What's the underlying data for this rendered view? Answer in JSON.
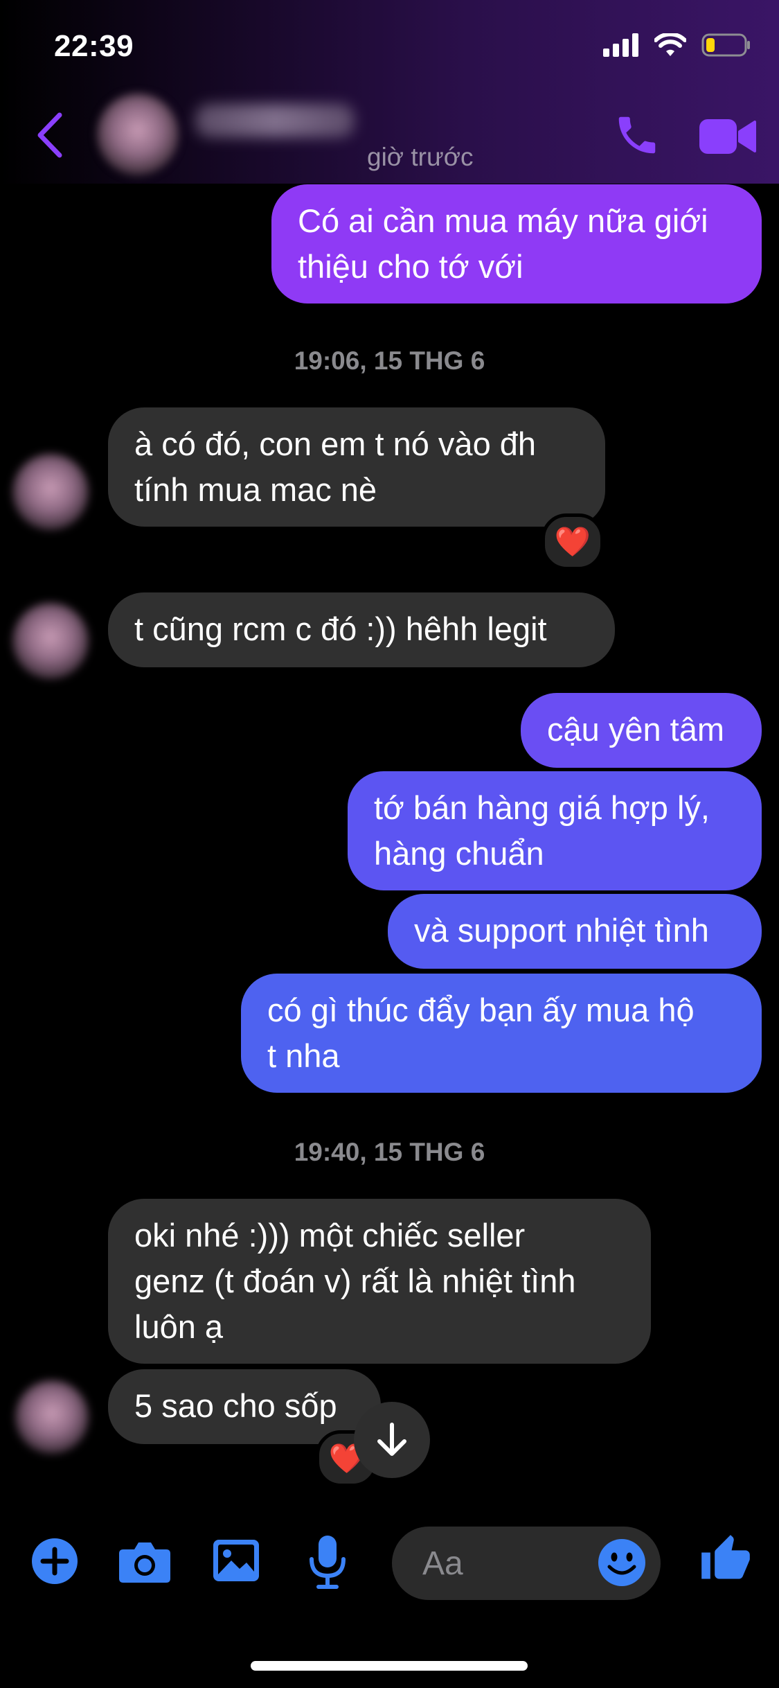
{
  "status_bar": {
    "time": "22:39",
    "icons": [
      "cellular-icon",
      "wifi-icon",
      "battery-icon"
    ]
  },
  "header": {
    "active_status": "giờ trước",
    "back_icon": "chevron-left-icon",
    "call_icon": "phone-icon",
    "video_icon": "video-camera-icon",
    "accent": "#8a3ffc"
  },
  "messages": [
    {
      "dir": "sent",
      "text": "Có ai cần mua máy nữa giới\nthiệu cho tớ với"
    },
    {
      "type": "timestamp",
      "text": "19:06, 15 THG 6"
    },
    {
      "dir": "received",
      "text": "à có đó, con em t nó vào đh\ntính mua mac nè",
      "reaction": "❤️"
    },
    {
      "dir": "received",
      "text": "t cũng rcm c đó :)) hêhh legit"
    },
    {
      "dir": "sent",
      "text": "cậu yên tâm"
    },
    {
      "dir": "sent",
      "text": "tớ bán hàng giá hợp lý,\nhàng chuẩn"
    },
    {
      "dir": "sent",
      "text": "và support nhiệt tình"
    },
    {
      "dir": "sent",
      "text": "có gì thúc đẩy bạn ấy mua hộ\nt nha"
    },
    {
      "type": "timestamp",
      "text": "19:40, 15 THG 6"
    },
    {
      "dir": "received",
      "text": "oki nhé :))) một chiếc seller\ngenz (t đoán v) rất là nhiệt tình\nluôn ạ"
    },
    {
      "dir": "received",
      "text": "5 sao cho sốp",
      "reaction": "❤️"
    }
  ],
  "composer": {
    "placeholder": "Aa",
    "tools": [
      "plus-icon",
      "camera-icon",
      "image-icon",
      "microphone-icon"
    ],
    "emoji_icon": "smiley-icon",
    "like_icon": "thumbs-up-icon",
    "accent": "#3b82f6"
  },
  "colors": {
    "sent_top": "#8e3bf6",
    "sent_bottom": "#4a63f0",
    "received": "#303030",
    "background": "#000000"
  }
}
